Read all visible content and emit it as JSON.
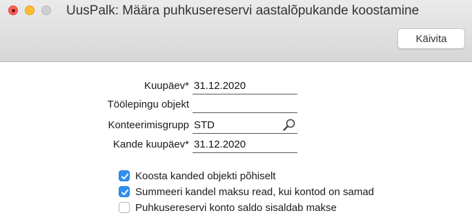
{
  "window": {
    "title": "UusPalk: Määra puhkusereservi aastalõpukande koostamine",
    "run_button": "Käivita"
  },
  "form": {
    "fields": [
      {
        "label": "Kuupäev*",
        "value": "31.12.2020"
      },
      {
        "label": "Töölepingu objekt",
        "value": ""
      },
      {
        "label": "Konteerimisgrupp",
        "value": "STD"
      },
      {
        "label": "Kande kuupäev*",
        "value": "31.12.2020"
      }
    ],
    "checkboxes": [
      {
        "label": "Koosta kanded objekti põhiselt",
        "checked": true
      },
      {
        "label": "Summeeri kandel maksu read, kui kontod on samad",
        "checked": true
      },
      {
        "label": "Puhkusereservi konto saldo sisaldab makse",
        "checked": false
      }
    ]
  },
  "colors": {
    "accent": "#2f8ff3",
    "close": "#fe5f57",
    "minimize": "#febc2e"
  },
  "icons": {
    "lookup": "search-icon"
  }
}
